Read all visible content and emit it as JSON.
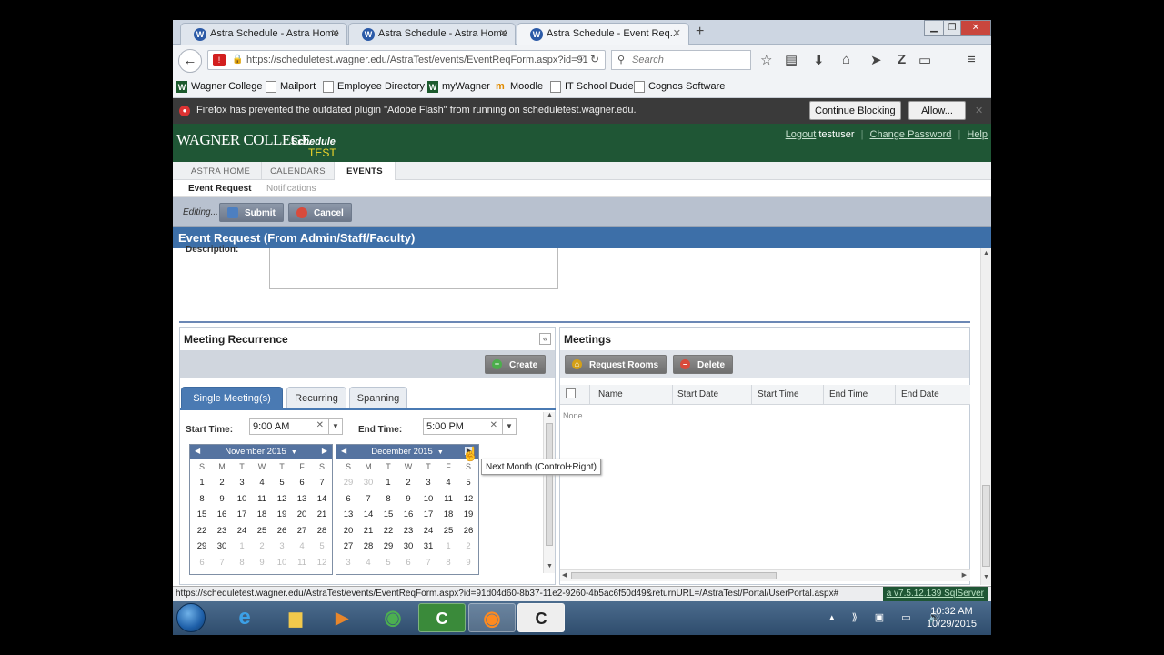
{
  "browser": {
    "tabs": [
      {
        "title": "Astra Schedule - Astra Home"
      },
      {
        "title": "Astra Schedule - Astra Home"
      },
      {
        "title": "Astra Schedule - Event Req..."
      }
    ],
    "new_tab": "+",
    "url": "https://scheduletest.wagner.edu/AstraTest/events/EventReqForm.aspx?id=91",
    "search_placeholder": "Search",
    "bookmarks": [
      "Wagner College",
      "Mailport",
      "Employee Directory",
      "myWagner",
      "Moodle",
      "IT School Dude",
      "Cognos Software"
    ],
    "notification": "Firefox has prevented the outdated plugin \"Adobe Flash\" from running on scheduletest.wagner.edu.",
    "continue_blocking": "Continue Blocking",
    "allow": "Allow...",
    "status_url": "https://scheduletest.wagner.edu/AstraTest/events/EventReqForm.aspx?id=91d04d60-8b37-11e2-9260-4b5ac6f50d49&returnURL=/AstraTest/Portal/UserPortal.aspx#",
    "status_version": "a v7.5.12.139 SqlServer"
  },
  "header": {
    "logo": "WAGNER COLLEGE",
    "logo_schedule": "Schedule",
    "logo_test": "TEST",
    "logout": "Logout",
    "user": "testuser",
    "change_password": "Change Password",
    "help": "Help"
  },
  "nav": {
    "tabs": [
      "ASTRA HOME",
      "CALENDARS",
      "EVENTS"
    ],
    "sub": [
      "Event Request",
      "Notifications"
    ]
  },
  "toolbar": {
    "editing": "Editing...",
    "submit": "Submit",
    "cancel": "Cancel"
  },
  "page_title": "Event Request (From Admin/Staff/Faculty)",
  "form": {
    "description_label": "Description:"
  },
  "recurrence": {
    "title": "Meeting Recurrence",
    "collapse": "«",
    "create": "Create",
    "tabs": [
      "Single Meeting(s)",
      "Recurring",
      "Spanning"
    ],
    "start_label": "Start Time:",
    "start_value": "9:00 AM",
    "end_label": "End Time:",
    "end_value": "5:00 PM",
    "tooltip": "Next Month (Control+Right)",
    "calendars": [
      {
        "month": "November 2015",
        "dows": [
          "S",
          "M",
          "T",
          "W",
          "T",
          "F",
          "S"
        ],
        "weeks": [
          [
            "1",
            "2",
            "3",
            "4",
            "5",
            "6",
            "7"
          ],
          [
            "8",
            "9",
            "10",
            "11",
            "12",
            "13",
            "14"
          ],
          [
            "15",
            "16",
            "17",
            "18",
            "19",
            "20",
            "21"
          ],
          [
            "22",
            "23",
            "24",
            "25",
            "26",
            "27",
            "28"
          ],
          [
            "29",
            "30",
            "1",
            "2",
            "3",
            "4",
            "5"
          ],
          [
            "6",
            "7",
            "8",
            "9",
            "10",
            "11",
            "12"
          ]
        ]
      },
      {
        "month": "December 2015",
        "dows": [
          "S",
          "M",
          "T",
          "W",
          "T",
          "F",
          "S"
        ],
        "weeks": [
          [
            "29",
            "30",
            "1",
            "2",
            "3",
            "4",
            "5"
          ],
          [
            "6",
            "7",
            "8",
            "9",
            "10",
            "11",
            "12"
          ],
          [
            "13",
            "14",
            "15",
            "16",
            "17",
            "18",
            "19"
          ],
          [
            "20",
            "21",
            "22",
            "23",
            "24",
            "25",
            "26"
          ],
          [
            "27",
            "28",
            "29",
            "30",
            "31",
            "1",
            "2"
          ],
          [
            "3",
            "4",
            "5",
            "6",
            "7",
            "8",
            "9"
          ]
        ]
      }
    ]
  },
  "meetings": {
    "title": "Meetings",
    "request_rooms": "Request Rooms",
    "delete": "Delete",
    "columns": [
      "Name",
      "Start Date",
      "Start Time",
      "End Time",
      "End Date"
    ],
    "empty": "None"
  },
  "taskbar": {
    "time": "10:32 AM",
    "date": "10/29/2015"
  }
}
